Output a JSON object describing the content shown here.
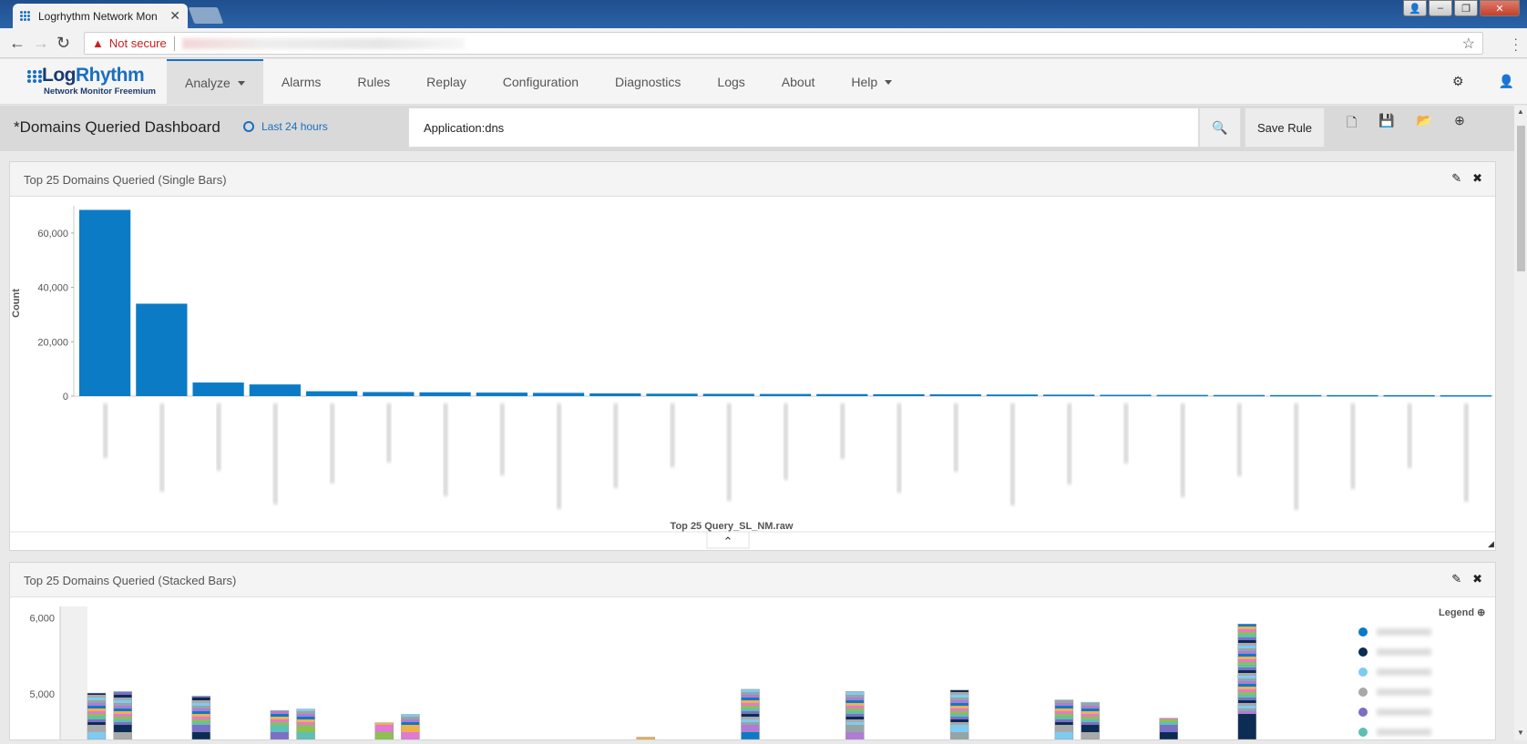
{
  "browser": {
    "tab_title": "Logrhythm Network Mon",
    "security_label": "Not secure"
  },
  "app": {
    "logo_name_a": "Log",
    "logo_name_b": "Rhythm",
    "logo_sub": "Network Monitor Freemium",
    "nav": [
      {
        "label": "Analyze",
        "active": true,
        "caret": true
      },
      {
        "label": "Alarms"
      },
      {
        "label": "Rules"
      },
      {
        "label": "Replay"
      },
      {
        "label": "Configuration"
      },
      {
        "label": "Diagnostics"
      },
      {
        "label": "Logs"
      },
      {
        "label": "About"
      },
      {
        "label": "Help",
        "caret": true
      }
    ]
  },
  "toolbar": {
    "dashboard_title": "*Domains Queried Dashboard",
    "time_range": "Last 24 hours",
    "query": "Application:dns",
    "save_rule": "Save Rule"
  },
  "panel1": {
    "title": "Top 25 Domains Queried (Single Bars)"
  },
  "panel2": {
    "title": "Top 25 Domains Queried (Stacked Bars)",
    "legend_title": "Legend"
  },
  "chart_data": [
    {
      "type": "bar",
      "ylabel": "Count",
      "xlabel": "Top 25 Query_SL_NM.raw",
      "ylim": [
        0,
        70000
      ],
      "yticks": [
        "0",
        "20,000",
        "40,000",
        "60,000"
      ],
      "values": [
        68500,
        34000,
        5000,
        4300,
        1800,
        1500,
        1400,
        1300,
        1200,
        1000,
        900,
        850,
        800,
        750,
        700,
        650,
        600,
        550,
        500,
        450,
        420,
        400,
        380,
        350,
        320
      ],
      "color": "#0b7bc6"
    },
    {
      "type": "bar",
      "stacked": true,
      "ylim": [
        4400,
        6150
      ],
      "yticks": [
        "5,000",
        "6,000"
      ],
      "columns": [
        {
          "x": 0,
          "total": 5010
        },
        {
          "x": 1,
          "total": 5030
        },
        {
          "x": 4,
          "total": 4970
        },
        {
          "x": 7,
          "total": 4780
        },
        {
          "x": 8,
          "total": 4800
        },
        {
          "x": 11,
          "total": 4620
        },
        {
          "x": 12,
          "total": 4730
        },
        {
          "x": 21,
          "total": 4430
        },
        {
          "x": 25,
          "total": 5060
        },
        {
          "x": 29,
          "total": 5030
        },
        {
          "x": 33,
          "total": 5050
        },
        {
          "x": 37,
          "total": 4920
        },
        {
          "x": 38,
          "total": 4890
        },
        {
          "x": 41,
          "total": 4680
        },
        {
          "x": 44,
          "total": 5920
        }
      ],
      "legend_colors": [
        "#0b7bc6",
        "#0d2c54",
        "#7ecbf2",
        "#a9a9a9",
        "#7b6fc6",
        "#5fbfb5"
      ]
    }
  ]
}
